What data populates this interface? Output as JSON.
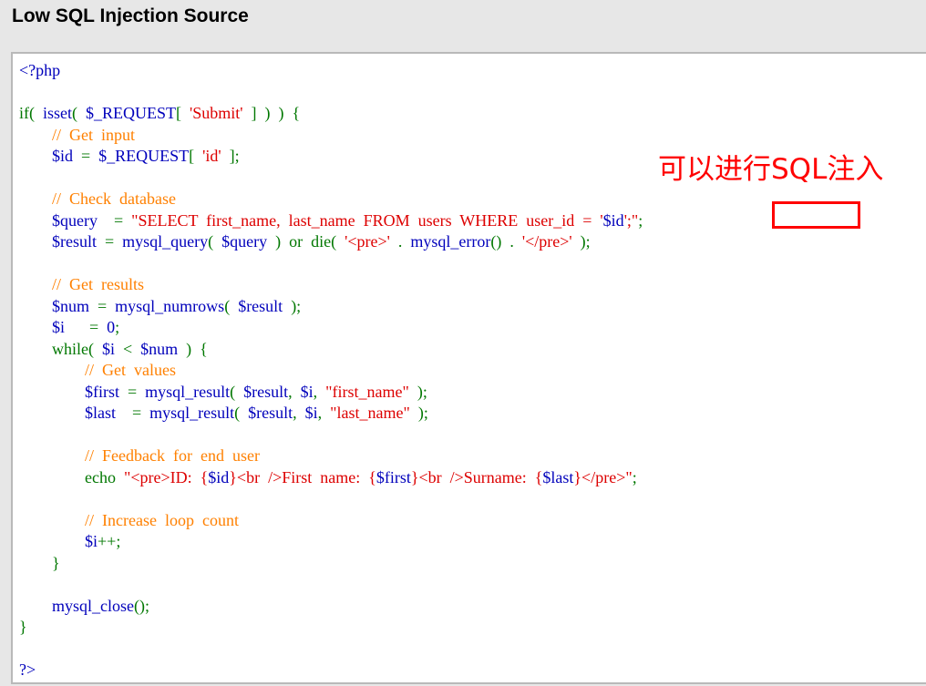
{
  "page": {
    "title": "Low SQL Injection Source"
  },
  "annotation": {
    "text": "可以进行SQL注入"
  },
  "code": {
    "lines": [
      [
        {
          "t": "<?php",
          "c": "default"
        }
      ],
      [],
      [
        {
          "t": "if(  ",
          "c": "keyword"
        },
        {
          "t": "isset",
          "c": "default"
        },
        {
          "t": "(  ",
          "c": "keyword"
        },
        {
          "t": "$_REQUEST",
          "c": "default"
        },
        {
          "t": "[  ",
          "c": "keyword"
        },
        {
          "t": "'Submit'",
          "c": "string"
        },
        {
          "t": "  ]  )  )  {",
          "c": "keyword"
        }
      ],
      [
        {
          "t": "        ",
          "c": "default"
        },
        {
          "t": "//  Get  input",
          "c": "comment"
        }
      ],
      [
        {
          "t": "        $id  ",
          "c": "default"
        },
        {
          "t": "=  ",
          "c": "keyword"
        },
        {
          "t": "$_REQUEST",
          "c": "default"
        },
        {
          "t": "[  ",
          "c": "keyword"
        },
        {
          "t": "'id'",
          "c": "string"
        },
        {
          "t": "  ];",
          "c": "keyword"
        }
      ],
      [],
      [
        {
          "t": "        ",
          "c": "default"
        },
        {
          "t": "//  Check  database",
          "c": "comment"
        }
      ],
      [
        {
          "t": "        $query    ",
          "c": "default"
        },
        {
          "t": "=  ",
          "c": "keyword"
        },
        {
          "t": "\"SELECT  first_name,  last_name  FROM  users  WHERE  user_id  =  '",
          "c": "string"
        },
        {
          "t": "$id",
          "c": "default"
        },
        {
          "t": "';\"",
          "c": "string"
        },
        {
          "t": ";",
          "c": "keyword"
        }
      ],
      [
        {
          "t": "        $result  ",
          "c": "default"
        },
        {
          "t": "=  ",
          "c": "keyword"
        },
        {
          "t": "mysql_query",
          "c": "default"
        },
        {
          "t": "(  ",
          "c": "keyword"
        },
        {
          "t": "$query  ",
          "c": "default"
        },
        {
          "t": ")  or  die(  ",
          "c": "keyword"
        },
        {
          "t": "'<pre>'  ",
          "c": "string"
        },
        {
          "t": ".  ",
          "c": "keyword"
        },
        {
          "t": "mysql_error",
          "c": "default"
        },
        {
          "t": "()  .  ",
          "c": "keyword"
        },
        {
          "t": "'</pre>'  ",
          "c": "string"
        },
        {
          "t": ");",
          "c": "keyword"
        }
      ],
      [],
      [
        {
          "t": "        ",
          "c": "default"
        },
        {
          "t": "//  Get  results",
          "c": "comment"
        }
      ],
      [
        {
          "t": "        $num  ",
          "c": "default"
        },
        {
          "t": "=  ",
          "c": "keyword"
        },
        {
          "t": "mysql_numrows",
          "c": "default"
        },
        {
          "t": "(  ",
          "c": "keyword"
        },
        {
          "t": "$result  ",
          "c": "default"
        },
        {
          "t": ");",
          "c": "keyword"
        }
      ],
      [
        {
          "t": "        $i      ",
          "c": "default"
        },
        {
          "t": "=  ",
          "c": "keyword"
        },
        {
          "t": "0",
          "c": "default"
        },
        {
          "t": ";",
          "c": "keyword"
        }
      ],
      [
        {
          "t": "        ",
          "c": "default"
        },
        {
          "t": "while(  ",
          "c": "keyword"
        },
        {
          "t": "$i  ",
          "c": "default"
        },
        {
          "t": "<  ",
          "c": "keyword"
        },
        {
          "t": "$num  ",
          "c": "default"
        },
        {
          "t": ")  {",
          "c": "keyword"
        }
      ],
      [
        {
          "t": "                ",
          "c": "default"
        },
        {
          "t": "//  Get  values",
          "c": "comment"
        }
      ],
      [
        {
          "t": "                $first  ",
          "c": "default"
        },
        {
          "t": "=  ",
          "c": "keyword"
        },
        {
          "t": "mysql_result",
          "c": "default"
        },
        {
          "t": "(  ",
          "c": "keyword"
        },
        {
          "t": "$result",
          "c": "default"
        },
        {
          "t": ",  ",
          "c": "keyword"
        },
        {
          "t": "$i",
          "c": "default"
        },
        {
          "t": ",  ",
          "c": "keyword"
        },
        {
          "t": "\"first_name\"  ",
          "c": "string"
        },
        {
          "t": ");",
          "c": "keyword"
        }
      ],
      [
        {
          "t": "                $last    ",
          "c": "default"
        },
        {
          "t": "=  ",
          "c": "keyword"
        },
        {
          "t": "mysql_result",
          "c": "default"
        },
        {
          "t": "(  ",
          "c": "keyword"
        },
        {
          "t": "$result",
          "c": "default"
        },
        {
          "t": ",  ",
          "c": "keyword"
        },
        {
          "t": "$i",
          "c": "default"
        },
        {
          "t": ",  ",
          "c": "keyword"
        },
        {
          "t": "\"last_name\"  ",
          "c": "string"
        },
        {
          "t": ");",
          "c": "keyword"
        }
      ],
      [],
      [
        {
          "t": "                ",
          "c": "default"
        },
        {
          "t": "//  Feedback  for  end  user",
          "c": "comment"
        }
      ],
      [
        {
          "t": "                ",
          "c": "default"
        },
        {
          "t": "echo  ",
          "c": "keyword"
        },
        {
          "t": "\"<pre>ID:  {",
          "c": "string"
        },
        {
          "t": "$id",
          "c": "default"
        },
        {
          "t": "}<br  />First  name:  {",
          "c": "string"
        },
        {
          "t": "$first",
          "c": "default"
        },
        {
          "t": "}<br  />Surname:  {",
          "c": "string"
        },
        {
          "t": "$last",
          "c": "default"
        },
        {
          "t": "}</pre>\"",
          "c": "string"
        },
        {
          "t": ";",
          "c": "keyword"
        }
      ],
      [],
      [
        {
          "t": "                ",
          "c": "default"
        },
        {
          "t": "//  Increase  loop  count",
          "c": "comment"
        }
      ],
      [
        {
          "t": "                $i",
          "c": "default"
        },
        {
          "t": "++;",
          "c": "keyword"
        }
      ],
      [
        {
          "t": "        ",
          "c": "default"
        },
        {
          "t": "}",
          "c": "keyword"
        }
      ],
      [],
      [
        {
          "t": "        ",
          "c": "default"
        },
        {
          "t": "mysql_close",
          "c": "default"
        },
        {
          "t": "();",
          "c": "keyword"
        }
      ],
      [
        {
          "t": "}",
          "c": "keyword"
        }
      ],
      [],
      [
        {
          "t": "?>",
          "c": "default"
        }
      ]
    ]
  },
  "colors": {
    "default": "#0000bb",
    "keyword": "#007700",
    "string": "#dd0000",
    "comment": "#ff8000",
    "annotation": "#ff0000"
  }
}
